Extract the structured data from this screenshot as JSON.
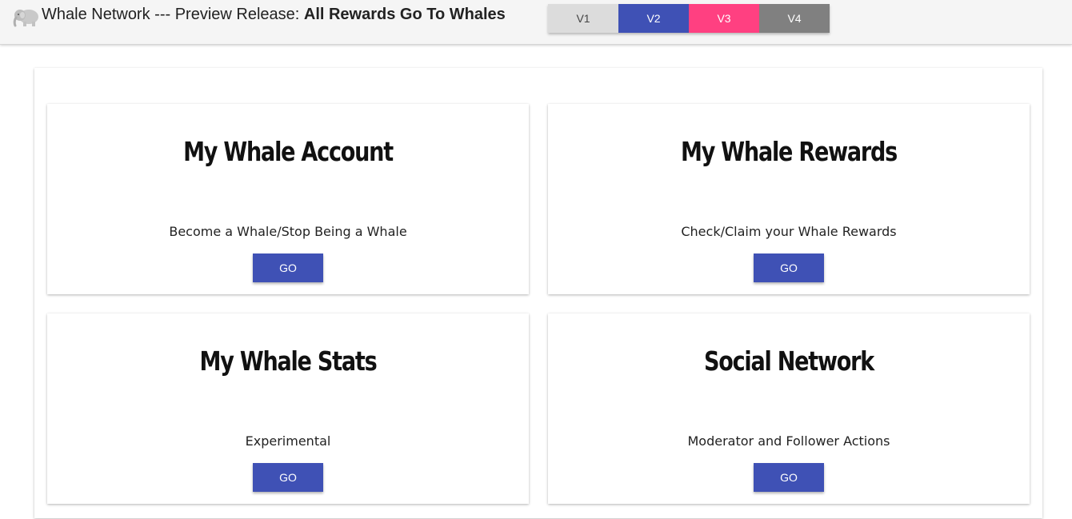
{
  "header": {
    "title_prefix": "Whale Network --- Preview Release: ",
    "title_bold": "All Rewards Go To Whales",
    "logo_icon": "elephant-icon"
  },
  "versions": [
    {
      "label": "V1",
      "color": "#dcdcdc"
    },
    {
      "label": "V2",
      "color": "#3f51b5"
    },
    {
      "label": "V3",
      "color": "#ff4081"
    },
    {
      "label": "V4",
      "color": "#808080"
    }
  ],
  "cards": [
    {
      "title": "My Whale Account",
      "description": "Become a Whale/Stop Being a Whale",
      "button": "GO"
    },
    {
      "title": "My Whale Rewards",
      "description": "Check/Claim your Whale Rewards",
      "button": "GO"
    },
    {
      "title": "My Whale Stats",
      "description": "Experimental",
      "button": "GO"
    },
    {
      "title": "Social Network",
      "description": "Moderator and Follower Actions",
      "button": "GO"
    }
  ],
  "colors": {
    "primary": "#3f51b5",
    "accent": "#ff4081"
  }
}
